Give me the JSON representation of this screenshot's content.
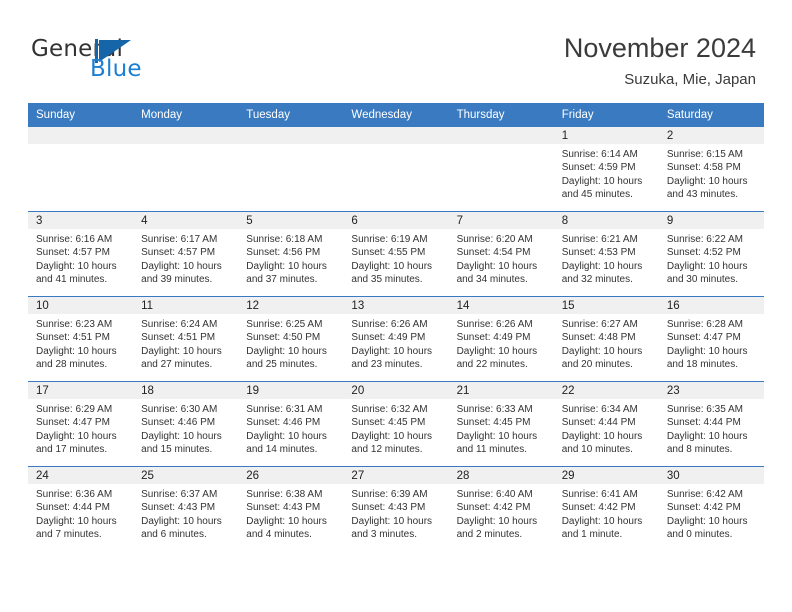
{
  "brand": {
    "word_one": "General",
    "word_two": "Blue",
    "accent_color": "#1c7fd1",
    "sail_icon": "triangle-sail-icon"
  },
  "header": {
    "title": "November 2024",
    "location": "Suzuka, Mie, Japan"
  },
  "calendar": {
    "header_bg": "#3a7ac0",
    "daynum_bg": "#f0f0f0",
    "weekdays": [
      "Sunday",
      "Monday",
      "Tuesday",
      "Wednesday",
      "Thursday",
      "Friday",
      "Saturday"
    ],
    "labels": {
      "sunrise": "Sunrise:",
      "sunset": "Sunset:",
      "daylight": "Daylight:"
    },
    "weeks": [
      [
        {
          "day": ""
        },
        {
          "day": ""
        },
        {
          "day": ""
        },
        {
          "day": ""
        },
        {
          "day": ""
        },
        {
          "day": "1",
          "sunrise": "Sunrise: 6:14 AM",
          "sunset": "Sunset: 4:59 PM",
          "daylight_1": "Daylight: 10 hours",
          "daylight_2": "and 45 minutes."
        },
        {
          "day": "2",
          "sunrise": "Sunrise: 6:15 AM",
          "sunset": "Sunset: 4:58 PM",
          "daylight_1": "Daylight: 10 hours",
          "daylight_2": "and 43 minutes."
        }
      ],
      [
        {
          "day": "3",
          "sunrise": "Sunrise: 6:16 AM",
          "sunset": "Sunset: 4:57 PM",
          "daylight_1": "Daylight: 10 hours",
          "daylight_2": "and 41 minutes."
        },
        {
          "day": "4",
          "sunrise": "Sunrise: 6:17 AM",
          "sunset": "Sunset: 4:57 PM",
          "daylight_1": "Daylight: 10 hours",
          "daylight_2": "and 39 minutes."
        },
        {
          "day": "5",
          "sunrise": "Sunrise: 6:18 AM",
          "sunset": "Sunset: 4:56 PM",
          "daylight_1": "Daylight: 10 hours",
          "daylight_2": "and 37 minutes."
        },
        {
          "day": "6",
          "sunrise": "Sunrise: 6:19 AM",
          "sunset": "Sunset: 4:55 PM",
          "daylight_1": "Daylight: 10 hours",
          "daylight_2": "and 35 minutes."
        },
        {
          "day": "7",
          "sunrise": "Sunrise: 6:20 AM",
          "sunset": "Sunset: 4:54 PM",
          "daylight_1": "Daylight: 10 hours",
          "daylight_2": "and 34 minutes."
        },
        {
          "day": "8",
          "sunrise": "Sunrise: 6:21 AM",
          "sunset": "Sunset: 4:53 PM",
          "daylight_1": "Daylight: 10 hours",
          "daylight_2": "and 32 minutes."
        },
        {
          "day": "9",
          "sunrise": "Sunrise: 6:22 AM",
          "sunset": "Sunset: 4:52 PM",
          "daylight_1": "Daylight: 10 hours",
          "daylight_2": "and 30 minutes."
        }
      ],
      [
        {
          "day": "10",
          "sunrise": "Sunrise: 6:23 AM",
          "sunset": "Sunset: 4:51 PM",
          "daylight_1": "Daylight: 10 hours",
          "daylight_2": "and 28 minutes."
        },
        {
          "day": "11",
          "sunrise": "Sunrise: 6:24 AM",
          "sunset": "Sunset: 4:51 PM",
          "daylight_1": "Daylight: 10 hours",
          "daylight_2": "and 27 minutes."
        },
        {
          "day": "12",
          "sunrise": "Sunrise: 6:25 AM",
          "sunset": "Sunset: 4:50 PM",
          "daylight_1": "Daylight: 10 hours",
          "daylight_2": "and 25 minutes."
        },
        {
          "day": "13",
          "sunrise": "Sunrise: 6:26 AM",
          "sunset": "Sunset: 4:49 PM",
          "daylight_1": "Daylight: 10 hours",
          "daylight_2": "and 23 minutes."
        },
        {
          "day": "14",
          "sunrise": "Sunrise: 6:26 AM",
          "sunset": "Sunset: 4:49 PM",
          "daylight_1": "Daylight: 10 hours",
          "daylight_2": "and 22 minutes."
        },
        {
          "day": "15",
          "sunrise": "Sunrise: 6:27 AM",
          "sunset": "Sunset: 4:48 PM",
          "daylight_1": "Daylight: 10 hours",
          "daylight_2": "and 20 minutes."
        },
        {
          "day": "16",
          "sunrise": "Sunrise: 6:28 AM",
          "sunset": "Sunset: 4:47 PM",
          "daylight_1": "Daylight: 10 hours",
          "daylight_2": "and 18 minutes."
        }
      ],
      [
        {
          "day": "17",
          "sunrise": "Sunrise: 6:29 AM",
          "sunset": "Sunset: 4:47 PM",
          "daylight_1": "Daylight: 10 hours",
          "daylight_2": "and 17 minutes."
        },
        {
          "day": "18",
          "sunrise": "Sunrise: 6:30 AM",
          "sunset": "Sunset: 4:46 PM",
          "daylight_1": "Daylight: 10 hours",
          "daylight_2": "and 15 minutes."
        },
        {
          "day": "19",
          "sunrise": "Sunrise: 6:31 AM",
          "sunset": "Sunset: 4:46 PM",
          "daylight_1": "Daylight: 10 hours",
          "daylight_2": "and 14 minutes."
        },
        {
          "day": "20",
          "sunrise": "Sunrise: 6:32 AM",
          "sunset": "Sunset: 4:45 PM",
          "daylight_1": "Daylight: 10 hours",
          "daylight_2": "and 12 minutes."
        },
        {
          "day": "21",
          "sunrise": "Sunrise: 6:33 AM",
          "sunset": "Sunset: 4:45 PM",
          "daylight_1": "Daylight: 10 hours",
          "daylight_2": "and 11 minutes."
        },
        {
          "day": "22",
          "sunrise": "Sunrise: 6:34 AM",
          "sunset": "Sunset: 4:44 PM",
          "daylight_1": "Daylight: 10 hours",
          "daylight_2": "and 10 minutes."
        },
        {
          "day": "23",
          "sunrise": "Sunrise: 6:35 AM",
          "sunset": "Sunset: 4:44 PM",
          "daylight_1": "Daylight: 10 hours",
          "daylight_2": "and 8 minutes."
        }
      ],
      [
        {
          "day": "24",
          "sunrise": "Sunrise: 6:36 AM",
          "sunset": "Sunset: 4:44 PM",
          "daylight_1": "Daylight: 10 hours",
          "daylight_2": "and 7 minutes."
        },
        {
          "day": "25",
          "sunrise": "Sunrise: 6:37 AM",
          "sunset": "Sunset: 4:43 PM",
          "daylight_1": "Daylight: 10 hours",
          "daylight_2": "and 6 minutes."
        },
        {
          "day": "26",
          "sunrise": "Sunrise: 6:38 AM",
          "sunset": "Sunset: 4:43 PM",
          "daylight_1": "Daylight: 10 hours",
          "daylight_2": "and 4 minutes."
        },
        {
          "day": "27",
          "sunrise": "Sunrise: 6:39 AM",
          "sunset": "Sunset: 4:43 PM",
          "daylight_1": "Daylight: 10 hours",
          "daylight_2": "and 3 minutes."
        },
        {
          "day": "28",
          "sunrise": "Sunrise: 6:40 AM",
          "sunset": "Sunset: 4:42 PM",
          "daylight_1": "Daylight: 10 hours",
          "daylight_2": "and 2 minutes."
        },
        {
          "day": "29",
          "sunrise": "Sunrise: 6:41 AM",
          "sunset": "Sunset: 4:42 PM",
          "daylight_1": "Daylight: 10 hours",
          "daylight_2": "and 1 minute."
        },
        {
          "day": "30",
          "sunrise": "Sunrise: 6:42 AM",
          "sunset": "Sunset: 4:42 PM",
          "daylight_1": "Daylight: 10 hours",
          "daylight_2": "and 0 minutes."
        }
      ]
    ]
  }
}
